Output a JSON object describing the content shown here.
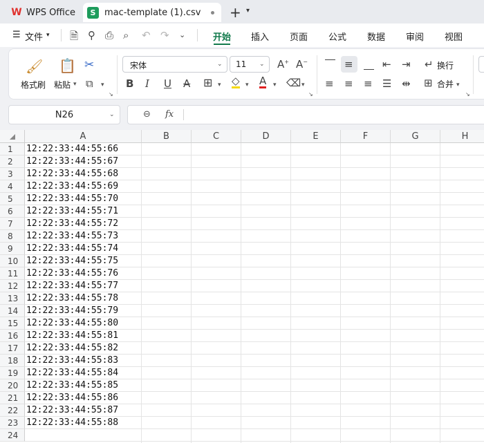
{
  "app": {
    "home_tab": "WPS Office",
    "file_tab": "mac-template (1).csv"
  },
  "menu": {
    "file_label": "文件",
    "tabs": [
      "开始",
      "插入",
      "页面",
      "公式",
      "数据",
      "审阅",
      "视图"
    ]
  },
  "ribbon": {
    "format_painter": "格式刷",
    "paste": "粘贴",
    "font_name": "宋体",
    "font_size": "11",
    "wrap_text": "换行",
    "merge": "合并"
  },
  "formula_bar": {
    "cell_ref": "N26",
    "fx": "fx",
    "content": ""
  },
  "sheet": {
    "columns": [
      "A",
      "B",
      "C",
      "D",
      "E",
      "F",
      "G",
      "H"
    ],
    "rows": [
      "1",
      "2",
      "3",
      "4",
      "5",
      "6",
      "7",
      "8",
      "9",
      "10",
      "11",
      "12",
      "13",
      "14",
      "15",
      "16",
      "17",
      "18",
      "19",
      "20",
      "21",
      "22",
      "23",
      "24"
    ],
    "column_a": [
      "12:22:33:44:55:66",
      "12:22:33:44:55:67",
      "12:22:33:44:55:68",
      "12:22:33:44:55:69",
      "12:22:33:44:55:70",
      "12:22:33:44:55:71",
      "12:22:33:44:55:72",
      "12:22:33:44:55:73",
      "12:22:33:44:55:74",
      "12:22:33:44:55:75",
      "12:22:33:44:55:76",
      "12:22:33:44:55:77",
      "12:22:33:44:55:78",
      "12:22:33:44:55:79",
      "12:22:33:44:55:80",
      "12:22:33:44:55:81",
      "12:22:33:44:55:82",
      "12:22:33:44:55:83",
      "12:22:33:44:55:84",
      "12:22:33:44:55:85",
      "12:22:33:44:55:86",
      "12:22:33:44:55:87",
      "12:22:33:44:55:88",
      ""
    ]
  },
  "colors": {
    "accent": "#127a4c",
    "wps_red": "#e0312d",
    "sheet_green": "#1e9c5c"
  }
}
